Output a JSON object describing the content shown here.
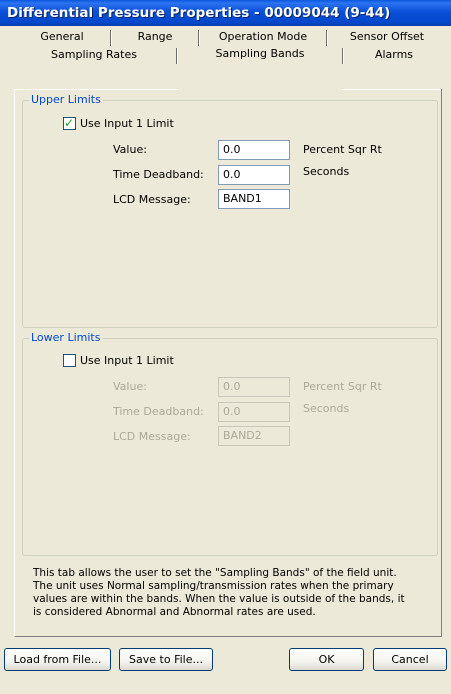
{
  "window": {
    "title": "Differential Pressure Properties - 00009044 (9-44)"
  },
  "tabs": {
    "row1": [
      "General",
      "Range",
      "Operation Mode",
      "Sensor Offset"
    ],
    "row2": [
      "Sampling Rates",
      "Sampling Bands",
      "Alarms"
    ],
    "selected": "Sampling Bands"
  },
  "upper": {
    "legend": "Upper Limits",
    "checkbox_label": "Use Input 1 Limit",
    "checked": true,
    "value_label": "Value:",
    "value": "0.0",
    "value_unit": "Percent Sqr Rt",
    "deadband_label": "Time Deadband:",
    "deadband": "0.0",
    "deadband_unit": "Seconds",
    "lcd_label": "LCD Message:",
    "lcd": "BAND1"
  },
  "lower": {
    "legend": "Lower Limits",
    "checkbox_label": "Use Input 1 Limit",
    "checked": false,
    "value_label": "Value:",
    "value": "0.0",
    "value_unit": "Percent Sqr Rt",
    "deadband_label": "Time Deadband:",
    "deadband": "0.0",
    "deadband_unit": "Seconds",
    "lcd_label": "LCD Message:",
    "lcd": "BAND2"
  },
  "description": "This tab allows the user to set the \"Sampling Bands\" of the field unit.\nThe unit uses Normal sampling/transmission rates when the primary\nvalues are within the bands.  When the value is outside of the bands, it\nis considered Abnormal and Abnormal rates are used.",
  "buttons": {
    "load": "Load from File...",
    "save": "Save to File...",
    "ok": "OK",
    "cancel": "Cancel"
  }
}
